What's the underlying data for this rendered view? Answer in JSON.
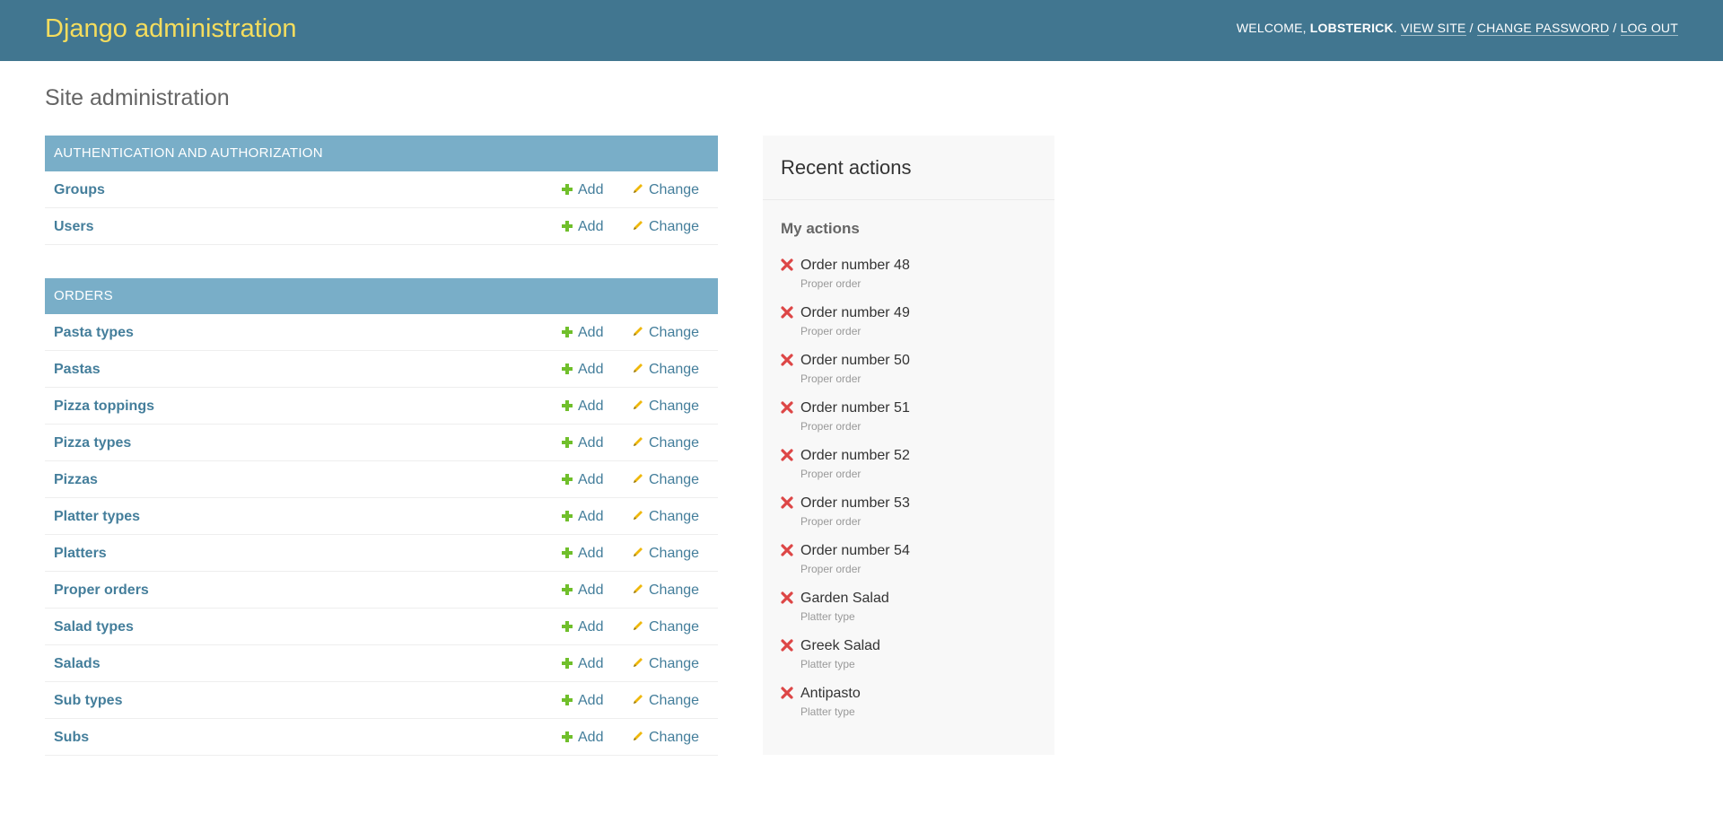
{
  "header": {
    "branding": "Django administration",
    "welcome": "WELCOME,",
    "username": "LOBSTERICK",
    "view_site": "VIEW SITE",
    "change_password": "CHANGE PASSWORD",
    "log_out": "LOG OUT",
    "separator": "/",
    "username_suffix": "."
  },
  "page": {
    "title": "Site administration"
  },
  "apps": [
    {
      "caption": "AUTHENTICATION AND AUTHORIZATION",
      "models": [
        {
          "name": "Groups",
          "add": "Add",
          "change": "Change"
        },
        {
          "name": "Users",
          "add": "Add",
          "change": "Change"
        }
      ]
    },
    {
      "caption": "ORDERS",
      "models": [
        {
          "name": "Pasta types",
          "add": "Add",
          "change": "Change"
        },
        {
          "name": "Pastas",
          "add": "Add",
          "change": "Change"
        },
        {
          "name": "Pizza toppings",
          "add": "Add",
          "change": "Change"
        },
        {
          "name": "Pizza types",
          "add": "Add",
          "change": "Change"
        },
        {
          "name": "Pizzas",
          "add": "Add",
          "change": "Change"
        },
        {
          "name": "Platter types",
          "add": "Add",
          "change": "Change"
        },
        {
          "name": "Platters",
          "add": "Add",
          "change": "Change"
        },
        {
          "name": "Proper orders",
          "add": "Add",
          "change": "Change"
        },
        {
          "name": "Salad types",
          "add": "Add",
          "change": "Change"
        },
        {
          "name": "Salads",
          "add": "Add",
          "change": "Change"
        },
        {
          "name": "Sub types",
          "add": "Add",
          "change": "Change"
        },
        {
          "name": "Subs",
          "add": "Add",
          "change": "Change"
        }
      ]
    }
  ],
  "recent_actions": {
    "title": "Recent actions",
    "subtitle": "My actions",
    "items": [
      {
        "name": "Order number 48",
        "type": "Proper order",
        "icon": "delete-icon"
      },
      {
        "name": "Order number 49",
        "type": "Proper order",
        "icon": "delete-icon"
      },
      {
        "name": "Order number 50",
        "type": "Proper order",
        "icon": "delete-icon"
      },
      {
        "name": "Order number 51",
        "type": "Proper order",
        "icon": "delete-icon"
      },
      {
        "name": "Order number 52",
        "type": "Proper order",
        "icon": "delete-icon"
      },
      {
        "name": "Order number 53",
        "type": "Proper order",
        "icon": "delete-icon"
      },
      {
        "name": "Order number 54",
        "type": "Proper order",
        "icon": "delete-icon"
      },
      {
        "name": "Garden Salad",
        "type": "Platter type",
        "icon": "delete-icon"
      },
      {
        "name": "Greek Salad",
        "type": "Platter type",
        "icon": "delete-icon"
      },
      {
        "name": "Antipasto",
        "type": "Platter type",
        "icon": "delete-icon"
      }
    ]
  },
  "colors": {
    "header_bg": "#417690",
    "branding": "#f5dd5d",
    "module_caption_bg": "#79aec8",
    "link": "#447e9b",
    "add_icon": "#70bf2b",
    "change_icon": "#efb80b",
    "delete_icon": "#dd4646"
  }
}
